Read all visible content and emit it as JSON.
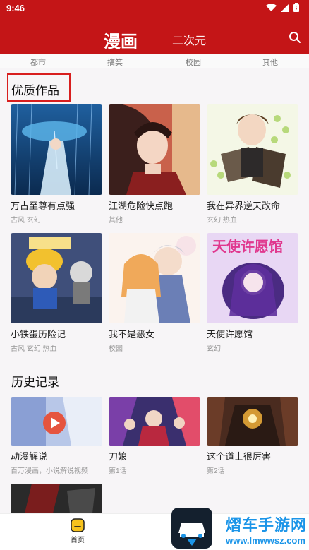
{
  "status": {
    "time": "9:46"
  },
  "header": {
    "tab_active": "漫画",
    "tab_other": "二次元"
  },
  "categories": [
    "都市",
    "搞笑",
    "校园",
    "其他"
  ],
  "sections": {
    "featured_title": "优质作品",
    "history_title": "历史记录"
  },
  "featured": [
    {
      "title": "万古至尊有点强",
      "meta": "古风 玄幻"
    },
    {
      "title": "江湖危险快点跑",
      "meta": "其他"
    },
    {
      "title": "我在异界逆天改命",
      "meta": "玄幻 热血"
    },
    {
      "title": "小铁蛋历险记",
      "meta": "古风 玄幻 热血"
    },
    {
      "title": "我不是恶女",
      "meta": "校园"
    },
    {
      "title": "天使许愿馆",
      "meta": "玄幻"
    }
  ],
  "history": [
    {
      "title": "动漫解说",
      "meta": "百万漫画，小说解说视频"
    },
    {
      "title": "刀娘",
      "meta": "第1话"
    },
    {
      "title": "这个道士很厉害",
      "meta": "第2话"
    }
  ],
  "cover_text": {
    "angel": "天使许愿馆"
  },
  "bottom_nav": {
    "home_label": "首页"
  },
  "watermark": {
    "name": "熠车手游网",
    "url": "www.lmwwsz.com"
  },
  "colors": {
    "brand": "#c41517",
    "highlight": "#d81e1e",
    "watermark": "#1b95e8"
  }
}
